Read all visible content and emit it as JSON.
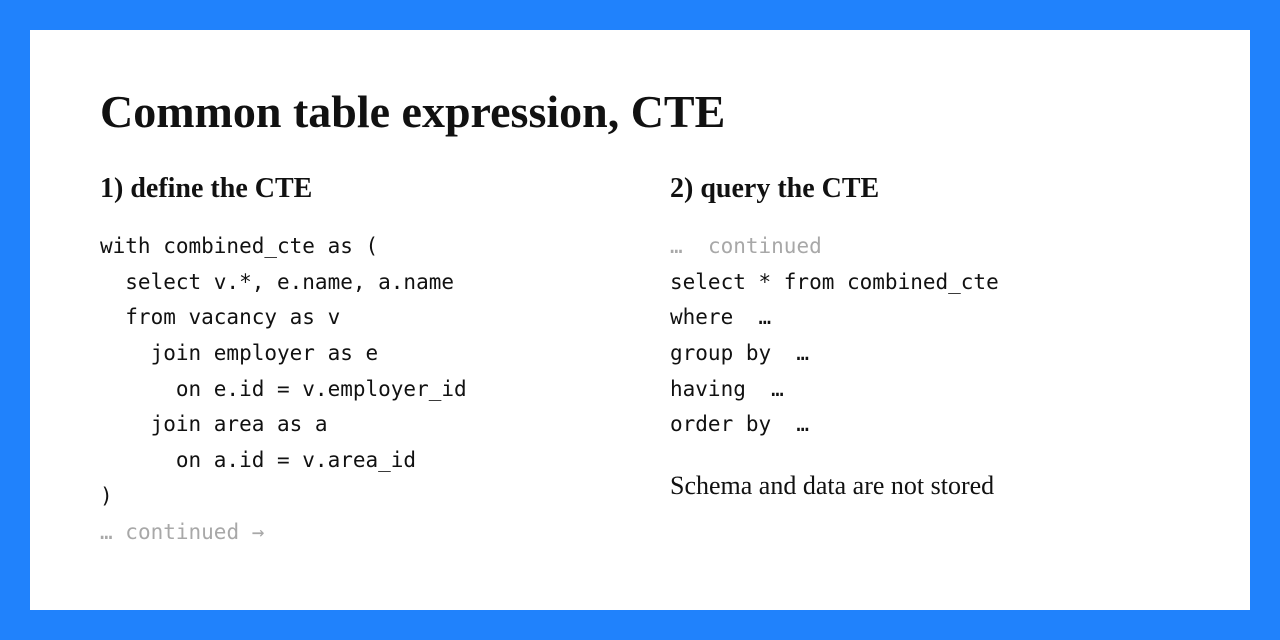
{
  "title": "Common table expression, CTE",
  "left": {
    "heading": "1) define the CTE",
    "code_lines": [
      "with combined_cte as (",
      "  select v.*, e.name, a.name",
      "  from vacancy as v",
      "    join employer as e",
      "      on e.id = v.employer_id",
      "    join area as a",
      "      on a.id = v.area_id",
      ")"
    ],
    "continued_prefix": "… ",
    "continued": "continued →"
  },
  "right": {
    "heading": "2) query the CTE",
    "continued_prefix": "…  ",
    "continued": "continued",
    "code_lines": [
      "select * from combined_cte",
      "where  …",
      "group by  …",
      "having  …",
      "order by  …"
    ],
    "note": "Schema and data are not stored"
  }
}
